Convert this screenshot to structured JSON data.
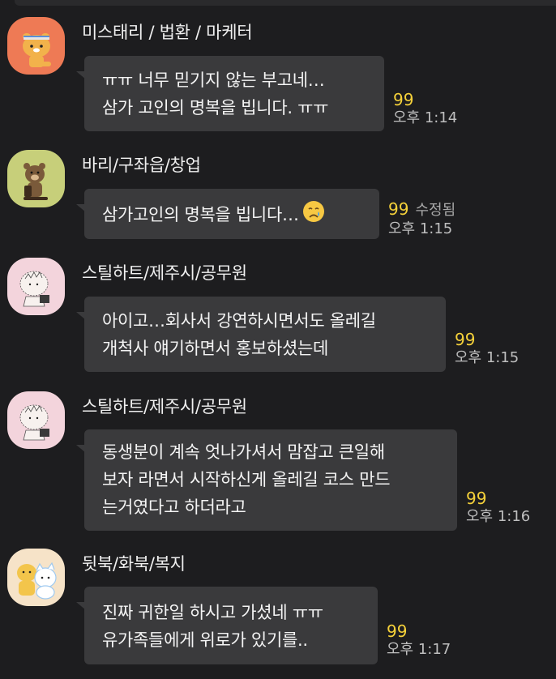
{
  "messages": [
    {
      "sender": "미스태리 / 법환 / 마케터",
      "lines": [
        "ㅠㅠ 너무 믿기지 않는 부고네…",
        "삼가 고인의 명복을 빕니다. ㅠㅠ"
      ],
      "unread": "99",
      "edited": "",
      "time": "오후 1:14",
      "avatar": "ryan-character-avatar"
    },
    {
      "sender": "바리/구좌읍/창업",
      "lines": [
        "삼가고인의 명복을 빕니다…"
      ],
      "emoji": "crying-face-emoji",
      "unread": "99",
      "edited": "수정됨",
      "time": "오후 1:15",
      "avatar": "bear-character-avatar"
    },
    {
      "sender": "스틸하트/제주시/공무원",
      "lines": [
        "아이고…회사서 강연하시면서도 올레길",
        "개척사 얘기하면서 홍보하셨는데"
      ],
      "unread": "99",
      "edited": "",
      "time": "오후 1:15",
      "avatar": "sketch-character-avatar"
    },
    {
      "sender": "스틸하트/제주시/공무원",
      "lines": [
        "동생분이 계속 엇나가셔서 맘잡고 큰일해",
        "보자 라면서 시작하신게 올레길 코스 만드",
        "는거였다고 하더라고"
      ],
      "unread": "99",
      "edited": "",
      "time": "오후 1:16",
      "avatar": "sketch-character-avatar"
    },
    {
      "sender": "뒷북/화북/복지",
      "lines": [
        "진짜 귀한일 하시고 가셨네 ㅠㅠ",
        "유가족들에게 위로가 있기를.."
      ],
      "unread": "99",
      "edited": "",
      "time": "오후 1:17",
      "avatar": "two-characters-avatar"
    }
  ],
  "colors": {
    "background": "#1d1d1f",
    "bubble": "#3a3a3c",
    "unread": "#f5d13a",
    "time": "#bfbfbf"
  }
}
